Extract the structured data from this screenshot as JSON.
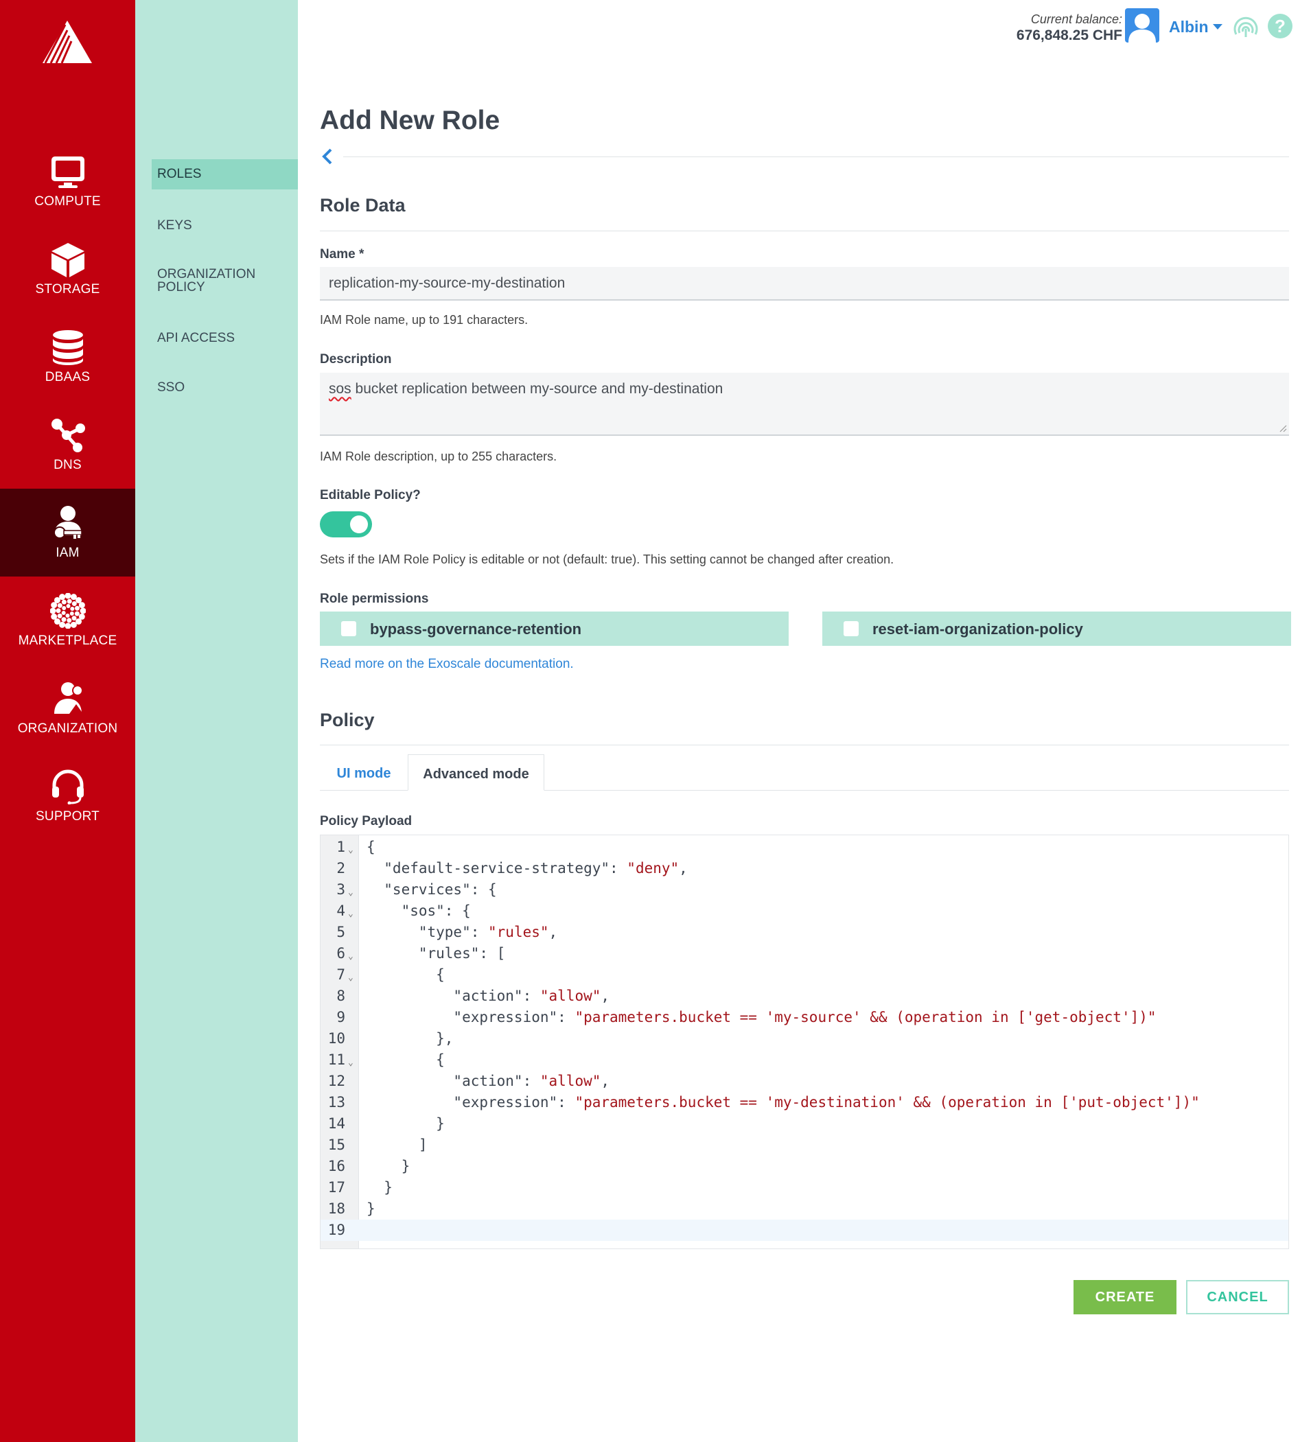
{
  "nav": {
    "items": [
      {
        "label": "COMPUTE",
        "icon": "monitor-icon"
      },
      {
        "label": "STORAGE",
        "icon": "cube-icon"
      },
      {
        "label": "DBAAS",
        "icon": "database-icon"
      },
      {
        "label": "DNS",
        "icon": "network-icon"
      },
      {
        "label": "IAM",
        "icon": "user-key-icon",
        "active": true
      },
      {
        "label": "MARKETPLACE",
        "icon": "marketplace-dots-icon"
      },
      {
        "label": "ORGANIZATION",
        "icon": "organization-icon"
      },
      {
        "label": "SUPPORT",
        "icon": "headset-icon"
      }
    ]
  },
  "subnav": {
    "items": [
      {
        "label": "ROLES",
        "active": true
      },
      {
        "label": "KEYS"
      },
      {
        "label": "ORGANIZATION POLICY"
      },
      {
        "label": "API ACCESS"
      },
      {
        "label": "SSO"
      }
    ]
  },
  "header": {
    "balance_label": "Current balance:",
    "balance_value": "676,848.25 CHF",
    "user_name": "Albin"
  },
  "page": {
    "title": "Add New Role",
    "role_data_title": "Role Data",
    "name_label": "Name *",
    "name_value": "replication-my-source-my-destination",
    "name_help": "IAM Role name, up to 191 characters.",
    "description_label": "Description",
    "description_first_word": "sos",
    "description_rest": " bucket replication between my-source and my-destination",
    "description_help": "IAM Role description, up to 255 characters.",
    "editable_label": "Editable Policy?",
    "editable_value": true,
    "editable_help": "Sets if the IAM Role Policy is editable or not (default: true). This setting cannot be changed after creation.",
    "permissions_label": "Role permissions",
    "permissions": [
      {
        "label": "bypass-governance-retention",
        "checked": false
      },
      {
        "label": "reset-iam-organization-policy",
        "checked": false
      }
    ],
    "doc_link": "Read more on the Exoscale documentation.",
    "policy_title": "Policy",
    "tabs": [
      {
        "label": "UI mode",
        "active": false
      },
      {
        "label": "Advanced mode",
        "active": true
      }
    ],
    "payload_label": "Policy Payload",
    "code_lines": [
      "{",
      "  \"default-service-strategy\": \"deny\",",
      "  \"services\": {",
      "    \"sos\": {",
      "      \"type\": \"rules\",",
      "      \"rules\": [",
      "        {",
      "          \"action\": \"allow\",",
      "          \"expression\": \"parameters.bucket == 'my-source' && (operation in ['get-object'])\"",
      "        },",
      "        {",
      "          \"action\": \"allow\",",
      "          \"expression\": \"parameters.bucket == 'my-destination' && (operation in ['put-object'])\"",
      "        }",
      "      ]",
      "    }",
      "  }",
      "}",
      ""
    ],
    "foldable_lines": [
      1,
      3,
      4,
      6,
      7,
      11
    ],
    "current_line": 19,
    "create_label": "CREATE",
    "cancel_label": "CANCEL"
  },
  "colors": {
    "nav_bg": "#c1000f",
    "nav_active": "#4a0006",
    "subnav_bg": "#b9e7da",
    "accent": "#34c49d",
    "link": "#2f86d8",
    "create": "#79bd4b",
    "string": "#a3151c"
  }
}
